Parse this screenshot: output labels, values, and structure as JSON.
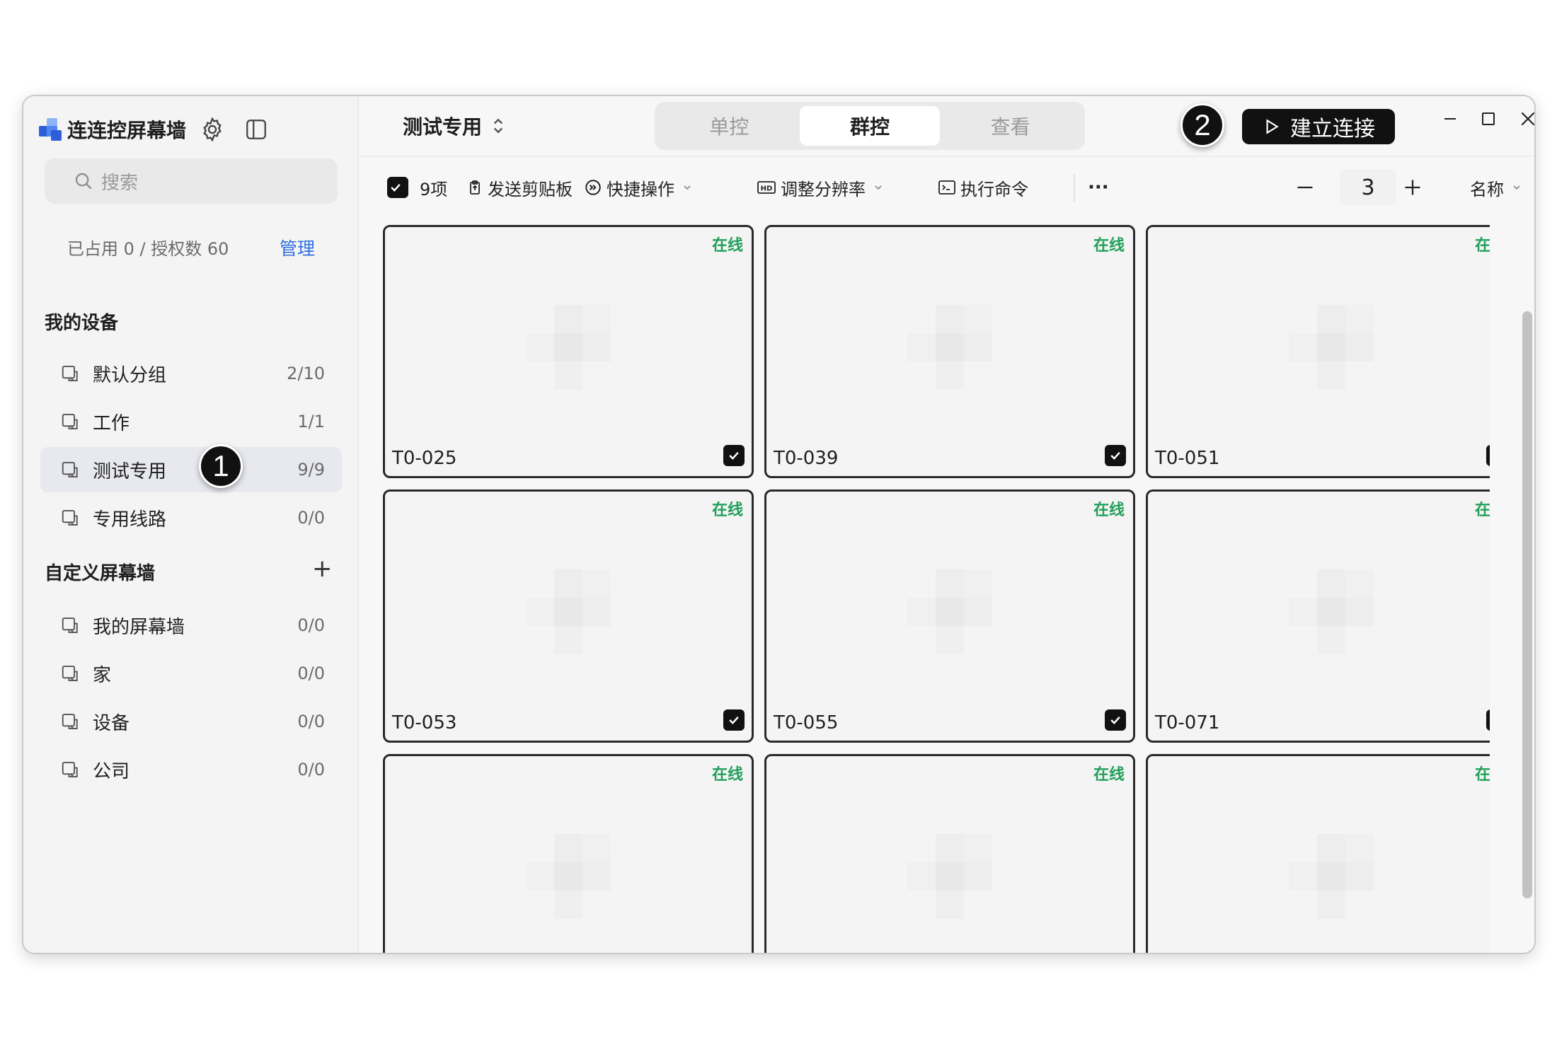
{
  "app": {
    "title": "连连控屏幕墙",
    "brand_colors": [
      "#2f5fd8",
      "#4f86f2",
      "#8fb5f8"
    ]
  },
  "sidebar": {
    "search_placeholder": "搜索",
    "quota_text": "已占用 0 / 授权数 60",
    "manage_label": "管理",
    "my_devices_title": "我的设备",
    "groups": [
      {
        "label": "默认分组",
        "count": "2/10"
      },
      {
        "label": "工作",
        "count": "1/1"
      },
      {
        "label": "测试专用",
        "count": "9/9",
        "active": true
      },
      {
        "label": "专用线路",
        "count": "0/0"
      }
    ],
    "custom_walls_title": "自定义屏幕墙",
    "add_label": "+",
    "walls": [
      {
        "label": "我的屏幕墙",
        "count": "0/0"
      },
      {
        "label": "家",
        "count": "0/0"
      },
      {
        "label": "设备",
        "count": "0/0"
      },
      {
        "label": "公司",
        "count": "0/0"
      }
    ]
  },
  "callouts": {
    "one": "1",
    "two": "2"
  },
  "topbar": {
    "current_group": "测试专用",
    "tabs": [
      {
        "label": "单控"
      },
      {
        "label": "群控",
        "active": true
      },
      {
        "label": "查看"
      }
    ],
    "connect_label": "建立连接"
  },
  "toolbar": {
    "selected_count": "9项",
    "send_clipboard": "发送剪贴板",
    "quick_actions": "快捷操作",
    "adjust_resolution": "调整分辨率",
    "run_command": "执行命令",
    "more": "···",
    "columns_value": "3",
    "sort_label": "名称"
  },
  "devices": [
    {
      "name": "T0-025",
      "status": "在线",
      "checked": true
    },
    {
      "name": "T0-039",
      "status": "在线",
      "checked": true
    },
    {
      "name": "T0-051",
      "status": "在线",
      "checked": true
    },
    {
      "name": "T0-053",
      "status": "在线",
      "checked": true
    },
    {
      "name": "T0-055",
      "status": "在线",
      "checked": true
    },
    {
      "name": "T0-071",
      "status": "在线",
      "checked": true
    },
    {
      "name": "",
      "status": "在线",
      "checked": true
    },
    {
      "name": "",
      "status": "在线",
      "checked": true
    },
    {
      "name": "",
      "status": "在线",
      "checked": true
    }
  ],
  "colors": {
    "accent_link": "#2f6fe4",
    "online": "#22a05a",
    "primary_button": "#111111"
  }
}
